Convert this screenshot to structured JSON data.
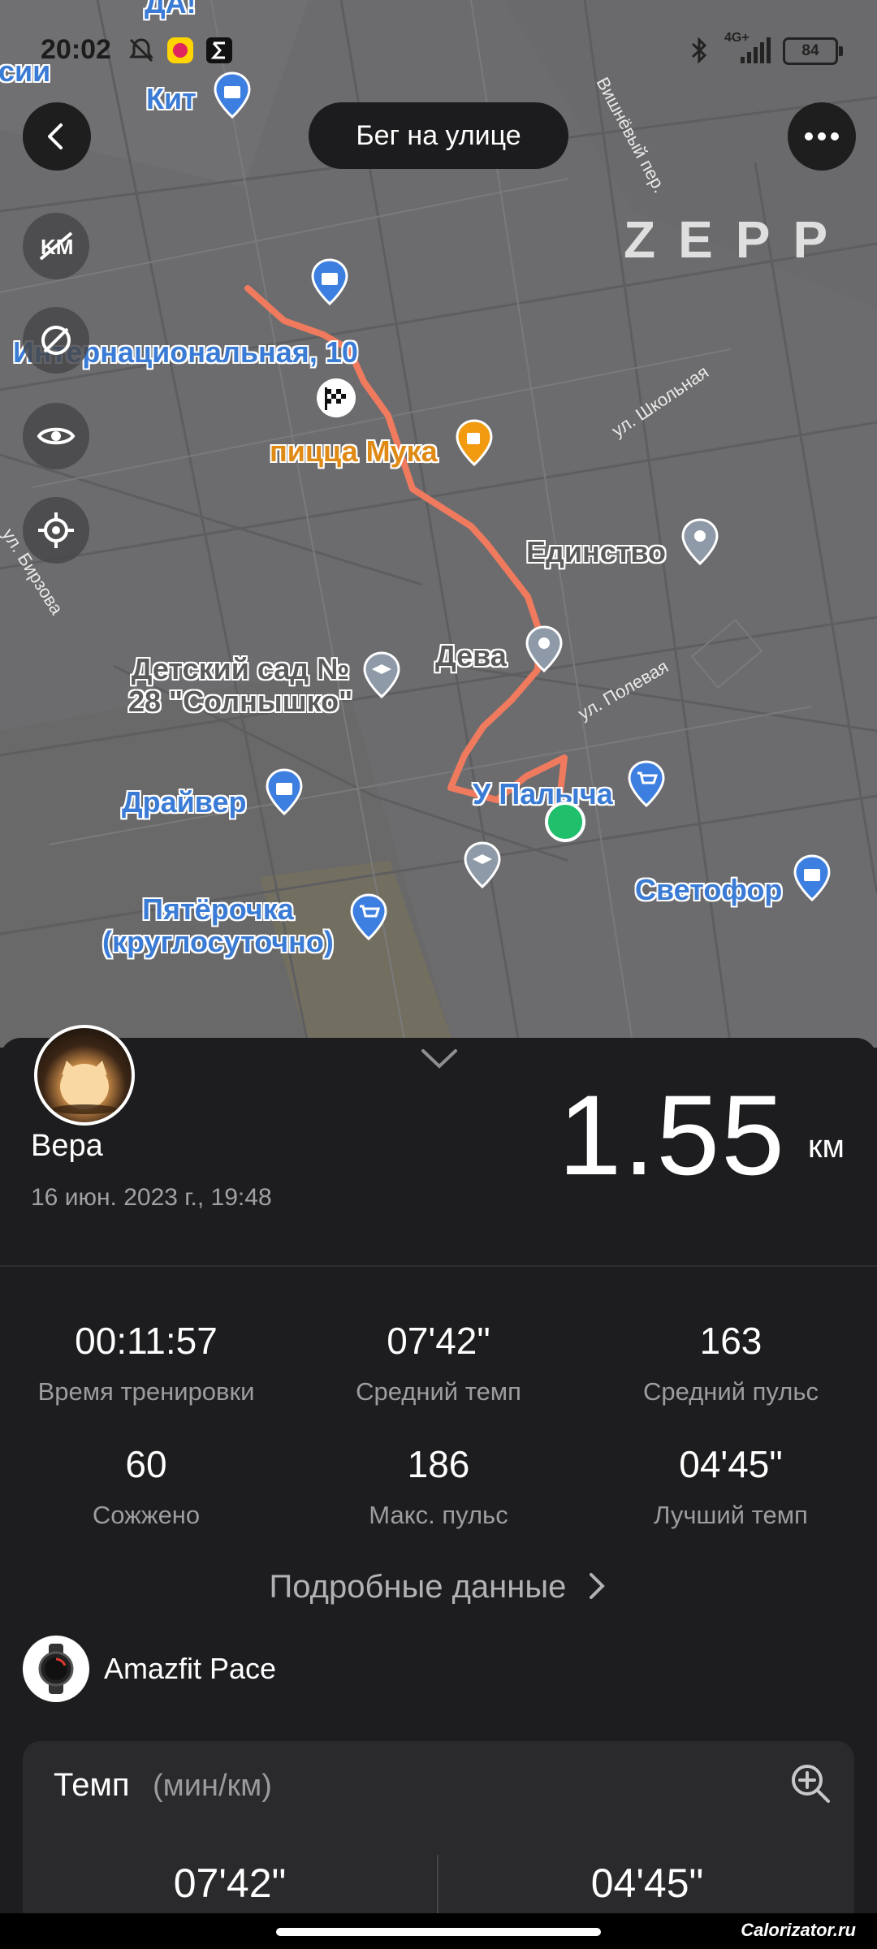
{
  "status_bar": {
    "time": "20:02",
    "battery": "84",
    "network": "4G+",
    "icons": [
      "bell-muted-icon",
      "music-app-icon",
      "sigma-app-icon",
      "bluetooth-icon",
      "signal-icon",
      "battery-icon"
    ]
  },
  "header": {
    "title": "Бег на улице",
    "back_icon": "back-arrow-icon",
    "more_icon": "more-dots-icon",
    "watermark": "ZEPP"
  },
  "map_controls": [
    "km-markers-hidden-icon",
    "hide-route-icon",
    "eye-icon",
    "locate-icon"
  ],
  "map": {
    "places": [
      {
        "name": "Кит",
        "color": "blue"
      },
      {
        "name": "Интернациональная, 10",
        "color": "blue"
      },
      {
        "name": "пицца Мука",
        "color": "orange"
      },
      {
        "name": "Единство",
        "color": "gray"
      },
      {
        "name": "Дева",
        "color": "gray"
      },
      {
        "name": "Детский сад №\n28 \"Солнышко\"",
        "color": "gray"
      },
      {
        "name": "Драйвер",
        "color": "blue"
      },
      {
        "name": "У Палыча",
        "color": "blue"
      },
      {
        "name": "Светофор",
        "color": "blue"
      },
      {
        "name": "Пятёрочка\n(круглосуточно)",
        "color": "blue"
      }
    ],
    "top_partial_labels": [
      "ДА!",
      "сии"
    ],
    "streets": [
      "ул. Школьная",
      "ул. Полевая",
      "ул. Бирзова",
      "Вишнёвый пер."
    ],
    "route_color": "#f07a5e",
    "end_marker_color": "#1fbf6b"
  },
  "summary": {
    "user_name": "Вера",
    "date": "16 июн. 2023 г., 19:48",
    "distance": "1.55",
    "distance_unit": "км"
  },
  "stats": [
    {
      "value": "00:11:57",
      "label": "Время тренировки"
    },
    {
      "value": "07'42\"",
      "label": "Средний темп"
    },
    {
      "value": "163",
      "label": "Средний пульс"
    },
    {
      "value": "60",
      "label": "Сожжено"
    },
    {
      "value": "186",
      "label": "Макс. пульс"
    },
    {
      "value": "04'45\"",
      "label": "Лучший темп"
    }
  ],
  "details_link": "Подробные данные",
  "device": {
    "name": "Amazfit Pace"
  },
  "pace_card": {
    "title": "Темп",
    "unit": "(мин/км)",
    "avg": "07'42\"",
    "best": "04'45\""
  },
  "watermark": "Calorizator.ru"
}
